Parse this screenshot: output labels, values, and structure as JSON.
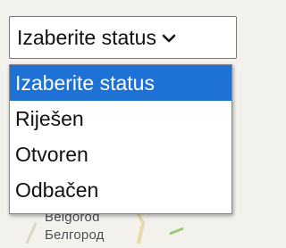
{
  "map": {
    "place_label_latin": "Belgorod",
    "place_label_cyrillic": "Белгород"
  },
  "status_select": {
    "selected_value": "Izaberite status",
    "chevron_icon": "chevron-down-icon",
    "options": [
      {
        "label": "Izaberite status",
        "selected": true
      },
      {
        "label": "Riješen",
        "selected": false
      },
      {
        "label": "Otvoren",
        "selected": false
      },
      {
        "label": "Odbačen",
        "selected": false
      }
    ]
  },
  "colors": {
    "highlight": "#1e72d6",
    "highlight_text": "#ffffff",
    "text": "#111111",
    "border": "#767676"
  }
}
